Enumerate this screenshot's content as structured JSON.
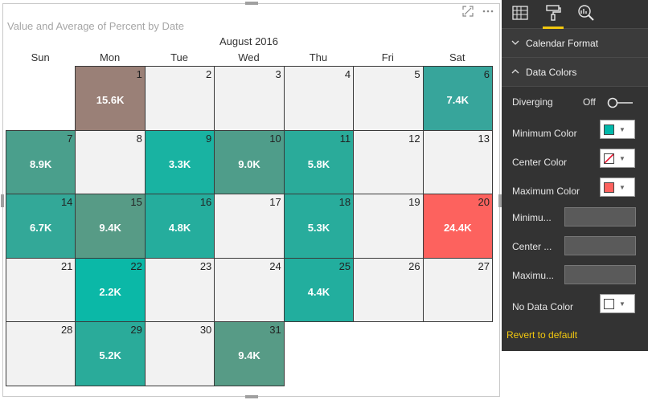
{
  "visual": {
    "title": "Value and Average of Percent by Date",
    "focus_icon": "focus-mode-icon",
    "more_icon": "more-options-icon"
  },
  "calendar": {
    "month_title": "August 2016",
    "weekdays": [
      "Sun",
      "Mon",
      "Tue",
      "Wed",
      "Thu",
      "Fri",
      "Sat"
    ],
    "no_data_color": "#f2f2f2",
    "days": [
      {
        "day": "1",
        "value": "15.6K",
        "color": "#9a8077"
      },
      {
        "day": "2",
        "value": "",
        "color": "#f2f2f2"
      },
      {
        "day": "3",
        "value": "",
        "color": "#f2f2f2"
      },
      {
        "day": "4",
        "value": "",
        "color": "#f2f2f2"
      },
      {
        "day": "5",
        "value": "",
        "color": "#f2f2f2"
      },
      {
        "day": "6",
        "value": "7.4K",
        "color": "#37a59b"
      },
      {
        "day": "7",
        "value": "8.9K",
        "color": "#4a9f8c"
      },
      {
        "day": "8",
        "value": "",
        "color": "#f2f2f2"
      },
      {
        "day": "9",
        "value": "3.3K",
        "color": "#19b3a2"
      },
      {
        "day": "10",
        "value": "9.0K",
        "color": "#4f9d8a"
      },
      {
        "day": "11",
        "value": "5.8K",
        "color": "#2aab9a"
      },
      {
        "day": "12",
        "value": "",
        "color": "#f2f2f2"
      },
      {
        "day": "13",
        "value": "",
        "color": "#f2f2f2"
      },
      {
        "day": "14",
        "value": "6.7K",
        "color": "#33a898"
      },
      {
        "day": "15",
        "value": "9.4K",
        "color": "#579b86"
      },
      {
        "day": "16",
        "value": "4.8K",
        "color": "#25ad9d"
      },
      {
        "day": "17",
        "value": "",
        "color": "#f2f2f2"
      },
      {
        "day": "18",
        "value": "5.3K",
        "color": "#28ac9c"
      },
      {
        "day": "19",
        "value": "",
        "color": "#f2f2f2"
      },
      {
        "day": "20",
        "value": "24.4K",
        "color": "#fd625e"
      },
      {
        "day": "21",
        "value": "",
        "color": "#f2f2f2"
      },
      {
        "day": "22",
        "value": "2.2K",
        "color": "#0bb8a7"
      },
      {
        "day": "23",
        "value": "",
        "color": "#f2f2f2"
      },
      {
        "day": "24",
        "value": "",
        "color": "#f2f2f2"
      },
      {
        "day": "25",
        "value": "4.4K",
        "color": "#22ae9e"
      },
      {
        "day": "26",
        "value": "",
        "color": "#f2f2f2"
      },
      {
        "day": "27",
        "value": "",
        "color": "#f2f2f2"
      },
      {
        "day": "28",
        "value": "",
        "color": "#f2f2f2"
      },
      {
        "day": "29",
        "value": "5.2K",
        "color": "#2aab9a"
      },
      {
        "day": "30",
        "value": "",
        "color": "#f2f2f2"
      },
      {
        "day": "31",
        "value": "9.4K",
        "color": "#579b86"
      }
    ]
  },
  "pane": {
    "tabs": [
      {
        "icon": "fields-icon",
        "active": false
      },
      {
        "icon": "format-paint-roller-icon",
        "active": true
      },
      {
        "icon": "analytics-icon",
        "active": false
      }
    ],
    "calendar_format_label": "Calendar Format",
    "data_colors_label": "Data Colors",
    "diverging_label": "Diverging",
    "diverging_state": "Off",
    "minimum_color_label": "Minimum Color",
    "minimum_color": "#01b8aa",
    "center_color_label": "Center Color",
    "maximum_color_label": "Maximum Color",
    "maximum_color": "#fd625e",
    "minimum_value_label": "Minimu...",
    "center_value_label": "Center ...",
    "maximum_value_label": "Maximu...",
    "no_data_color_label": "No Data Color",
    "no_data_color": "#ffffff",
    "revert_label": "Revert to default"
  }
}
